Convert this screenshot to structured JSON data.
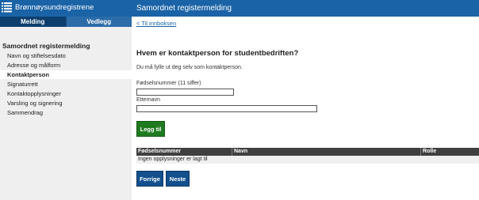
{
  "header": {
    "org_name": "Brønnøysundregistrene",
    "app_title": "Samordnet registermelding"
  },
  "tabs": [
    {
      "label": "Melding"
    },
    {
      "label": "Vedlegg"
    }
  ],
  "back_link": "< Til innboksen",
  "sidebar": {
    "title": "Samordnet registermelding",
    "items": [
      {
        "label": "Navn og stiftelsesdato"
      },
      {
        "label": "Adresse og målform"
      },
      {
        "label": "Kontaktperson"
      },
      {
        "label": "Signaturrett"
      },
      {
        "label": "Kontaktopplysninger"
      },
      {
        "label": "Varsling og signering"
      },
      {
        "label": "Sammendrag"
      }
    ]
  },
  "main": {
    "heading": "Hvem er kontaktperson for studentbedriften?",
    "instruction": "Du må fylle ut deg selv som kontaktperson.",
    "fields": [
      {
        "label": "Fødselsnummer (11 siffer)",
        "value": ""
      },
      {
        "label": "Etternavn",
        "value": ""
      }
    ],
    "add_button": "Legg til",
    "table": {
      "columns": [
        "Fødselsnummer",
        "Navn",
        "Rolle"
      ],
      "empty_text": "Ingen opplysninger er lagt til"
    },
    "prev_button": "Forrige",
    "next_button": "Neste"
  },
  "colors": {
    "header_bg": "#1a63a6",
    "active_tab": "#0d3f6e",
    "add_button": "#1f7a1f",
    "nav_button": "#13508d"
  }
}
